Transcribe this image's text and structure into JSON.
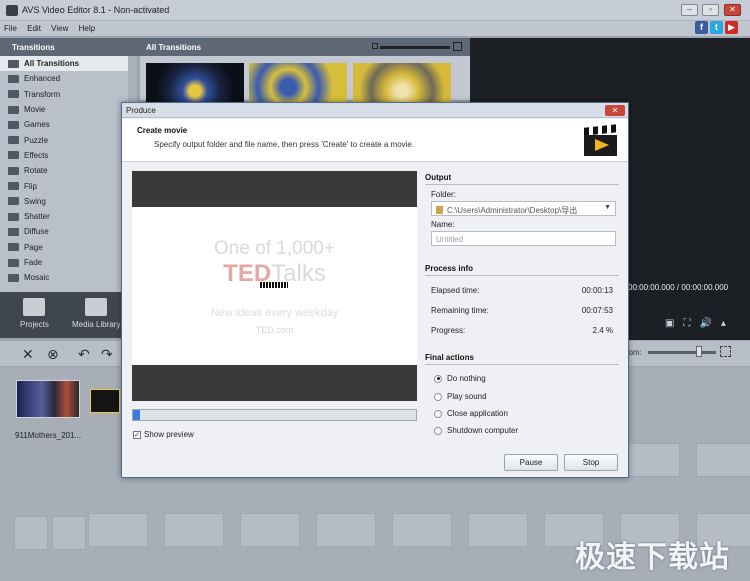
{
  "app": {
    "title": "AVS Video Editor 8.1 - Non-activated"
  },
  "menu": [
    "File",
    "Edit",
    "View",
    "Help"
  ],
  "social": {
    "facebook": "f",
    "twitter": "t"
  },
  "transitions_panel": {
    "header": "Transitions",
    "items": [
      "All Transitions",
      "Enhanced",
      "Transform",
      "Movie",
      "Games",
      "Puzzle",
      "Effects",
      "Rotate",
      "Flip",
      "Swing",
      "Shatter",
      "Diffuse",
      "Page",
      "Fade",
      "Mosaic"
    ],
    "active_index": 0,
    "content_header": "All Transitions"
  },
  "tools": {
    "projects": "Projects",
    "media_library": "Media Library"
  },
  "player": {
    "time": "00:00:00.000 / 00:00:00.000"
  },
  "timeline": {
    "zoom_label": "oom:",
    "clip_name": "911Mothers_201..."
  },
  "watermark": "极速下载站",
  "dialog": {
    "title": "Produce",
    "close": "✕",
    "heading": "Create movie",
    "subheading": "Specify output folder and file name, then press 'Create' to create a movie.",
    "preview": {
      "line1": "One of 1,000+",
      "ted": "TED",
      "talks": "Talks",
      "line3": "New ideas every weekday",
      "line4": "TED.com"
    },
    "progress_fraction": 0.024,
    "show_preview_label": "Show preview",
    "show_preview_checked": true,
    "output": {
      "section": "Output",
      "folder_label": "Folder:",
      "folder_value": "C:\\Users\\Administrator\\Desktop\\导出",
      "name_label": "Name:",
      "name_placeholder": "Untitled"
    },
    "process": {
      "section": "Process info",
      "elapsed_label": "Elapsed time:",
      "elapsed_value": "00:00:13",
      "remaining_label": "Remaining time:",
      "remaining_value": "00:07:53",
      "progress_label": "Progress:",
      "progress_value": "2.4 %"
    },
    "final": {
      "section": "Final actions",
      "options": [
        "Do nothing",
        "Play sound",
        "Close application",
        "Shutdown computer"
      ],
      "selected_index": 0
    },
    "buttons": {
      "pause": "Pause",
      "stop": "Stop"
    }
  }
}
